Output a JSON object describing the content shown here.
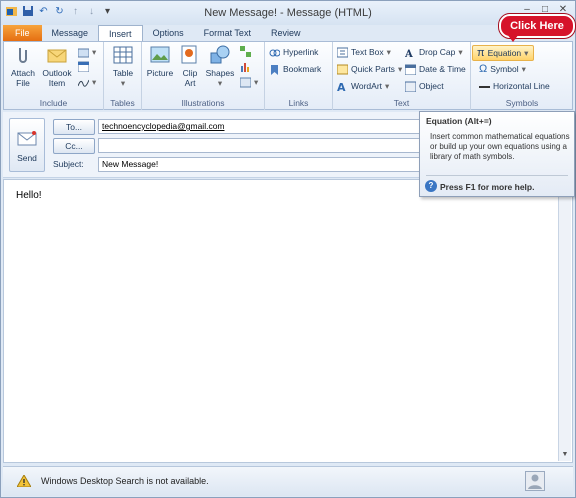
{
  "window": {
    "title": "New Message! - Message (HTML)"
  },
  "tabs": [
    "File",
    "Message",
    "Insert",
    "Options",
    "Format Text",
    "Review"
  ],
  "active_tab": "Insert",
  "ribbon": {
    "include": {
      "label": "Include",
      "attach_file": "Attach File",
      "outlook_item": "Outlook Item"
    },
    "tables": {
      "label": "Tables",
      "table": "Table"
    },
    "illustrations": {
      "label": "Illustrations",
      "picture": "Picture",
      "clip_art": "Clip Art",
      "shapes": "Shapes"
    },
    "links": {
      "label": "Links",
      "hyperlink": "Hyperlink",
      "bookmark": "Bookmark"
    },
    "text": {
      "label": "Text",
      "text_box": "Text Box",
      "quick_parts": "Quick Parts",
      "wordart": "WordArt",
      "drop_cap": "Drop Cap",
      "date_time": "Date & Time",
      "object": "Object"
    },
    "symbols": {
      "label": "Symbols",
      "equation": "Equation",
      "symbol": "Symbol",
      "horizontal_line": "Horizontal Line"
    }
  },
  "callout": "Click Here",
  "tooltip": {
    "title": "Equation (Alt+=)",
    "body": "Insert common mathematical equations or build up your own equations using a library of math symbols.",
    "help": "Press F1 for more help."
  },
  "compose": {
    "send": "Send",
    "to_label": "To...",
    "to_value": "technoencyclopedia@gmail.com",
    "cc_label": "Cc...",
    "cc_value": "",
    "subject_label": "Subject:",
    "subject_value": "New Message!",
    "body": "Hello!"
  },
  "status": {
    "message": "Windows Desktop Search is not available."
  }
}
